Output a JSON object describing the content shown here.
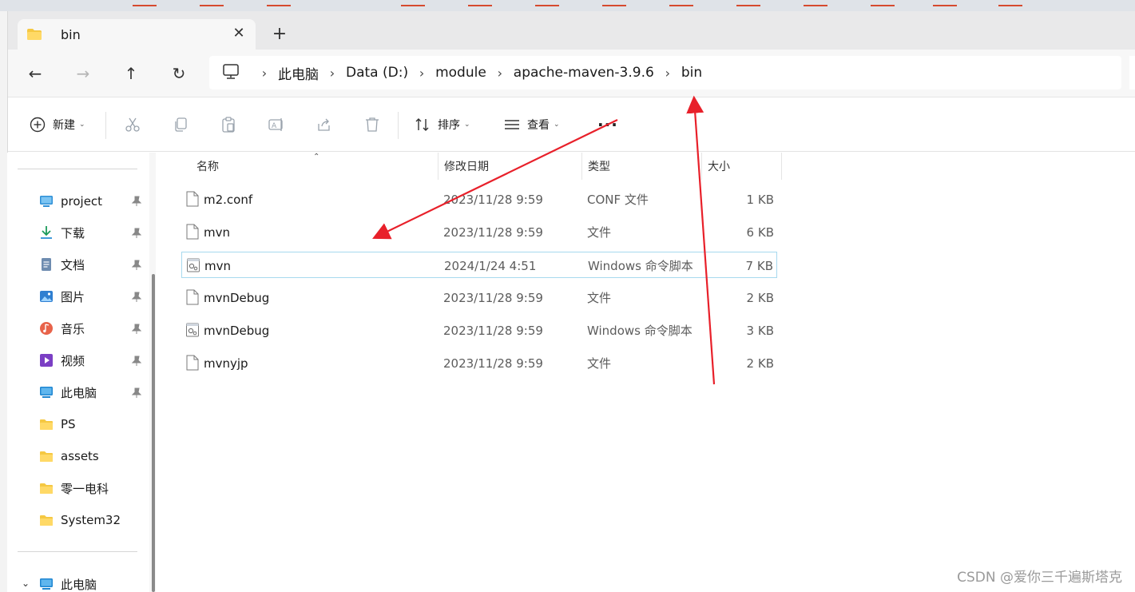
{
  "tab": {
    "title": "bin",
    "close_glyph": "✕",
    "new_tab_glyph": "+"
  },
  "nav": {
    "back": "←",
    "forward": "→",
    "up": "↑",
    "refresh": "↻"
  },
  "breadcrumb": [
    "此电脑",
    "Data (D:)",
    "module",
    "apache-maven-3.9.6",
    "bin"
  ],
  "breadcrumb_sep": "›",
  "commands": {
    "new_label": "新建",
    "sort_label": "排序",
    "view_label": "查看",
    "more_label": "···",
    "caret": "⌄"
  },
  "sidebar": {
    "items": [
      {
        "label": "project",
        "icon": "desktop-icon",
        "pinned": true
      },
      {
        "label": "下载",
        "icon": "download-icon",
        "pinned": true
      },
      {
        "label": "文档",
        "icon": "documents-icon",
        "pinned": true
      },
      {
        "label": "图片",
        "icon": "pictures-icon",
        "pinned": true
      },
      {
        "label": "音乐",
        "icon": "music-icon",
        "pinned": true
      },
      {
        "label": "视频",
        "icon": "videos-icon",
        "pinned": true
      },
      {
        "label": "此电脑",
        "icon": "computer-icon",
        "pinned": true
      },
      {
        "label": "PS",
        "icon": "folder-icon",
        "pinned": false
      },
      {
        "label": "assets",
        "icon": "folder-icon",
        "pinned": false
      },
      {
        "label": "零一电科",
        "icon": "folder-icon",
        "pinned": false
      },
      {
        "label": "System32",
        "icon": "folder-icon",
        "pinned": false
      }
    ],
    "bottom_item": {
      "label": "此电脑",
      "icon": "computer-icon",
      "chevron": "⌄"
    }
  },
  "columns": {
    "name": "名称",
    "date": "修改日期",
    "type": "类型",
    "size": "大小",
    "sort_caret": "⌃"
  },
  "files": [
    {
      "name": "m2.conf",
      "date": "2023/11/28 9:59",
      "type": "CONF 文件",
      "size": "1 KB",
      "icon": "file-icon"
    },
    {
      "name": "mvn",
      "date": "2023/11/28 9:59",
      "type": "文件",
      "size": "6 KB",
      "icon": "file-icon"
    },
    {
      "name": "mvn",
      "date": "2024/1/24 4:51",
      "type": "Windows 命令脚本",
      "size": "7 KB",
      "icon": "script-icon",
      "selected": true
    },
    {
      "name": "mvnDebug",
      "date": "2023/11/28 9:59",
      "type": "文件",
      "size": "2 KB",
      "icon": "file-icon"
    },
    {
      "name": "mvnDebug",
      "date": "2023/11/28 9:59",
      "type": "Windows 命令脚本",
      "size": "3 KB",
      "icon": "script-icon"
    },
    {
      "name": "mvnyjp",
      "date": "2023/11/28 9:59",
      "type": "文件",
      "size": "2 KB",
      "icon": "file-icon"
    }
  ],
  "watermark": "CSDN @爱你三千遍斯塔克",
  "colors": {
    "accent": "#0067c0",
    "annotation": "#e8202a",
    "selection_border": "#a7d9ee",
    "folder": "#f5c842"
  }
}
